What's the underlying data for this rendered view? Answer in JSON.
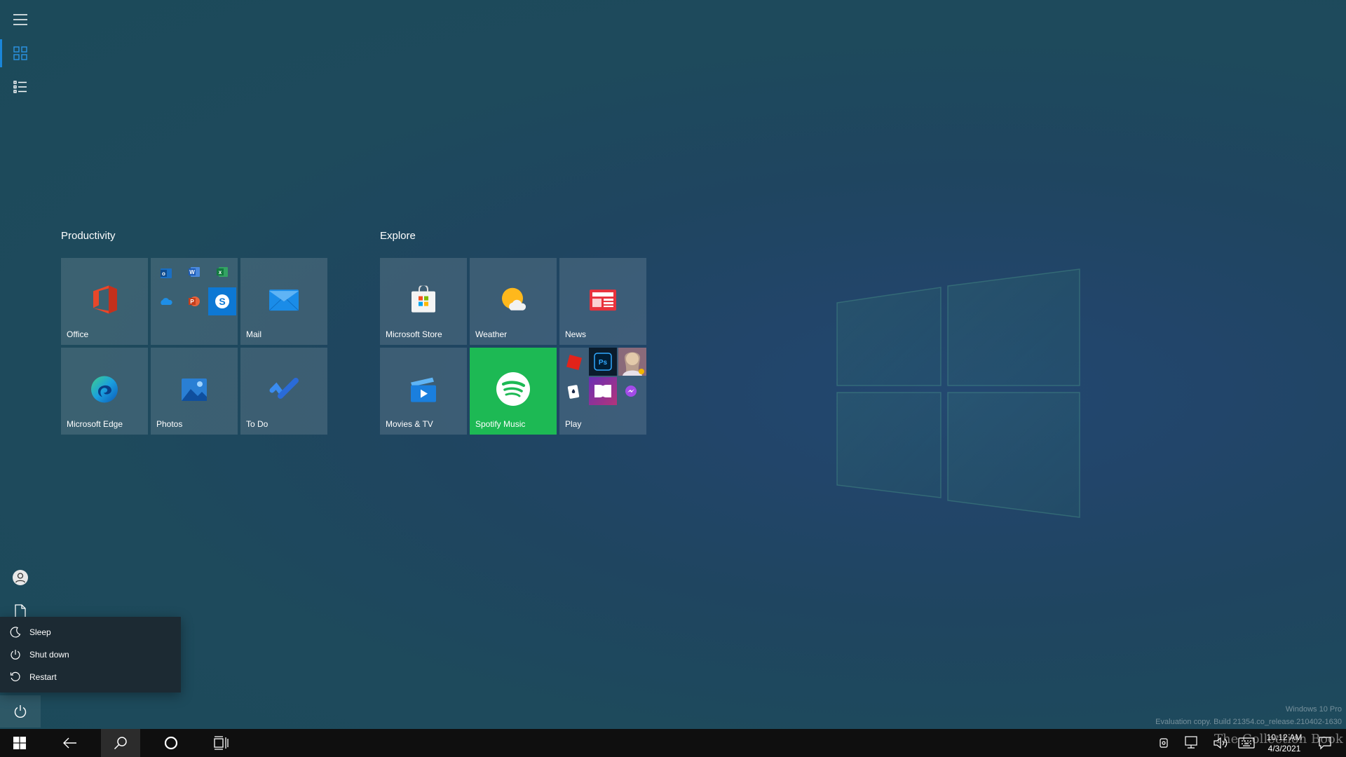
{
  "groups": [
    {
      "title": "Productivity"
    },
    {
      "title": "Explore"
    }
  ],
  "tiles": {
    "office": "Office",
    "mail": "Mail",
    "edge": "Microsoft Edge",
    "photos": "Photos",
    "todo": "To Do",
    "store": "Microsoft Store",
    "weather": "Weather",
    "news": "News",
    "movies": "Movies & TV",
    "spotify": "Spotify Music",
    "play": "Play"
  },
  "office_folder_apps": [
    "outlook-icon",
    "word-icon",
    "excel-icon",
    "onedrive-icon",
    "powerpoint-icon",
    "skype-icon"
  ],
  "play_folder_apps": [
    "roblox-icon",
    "photoshop-express-icon",
    "game-avatar-icon",
    "solitaire-icon",
    "dolby-icon",
    "messenger-icon"
  ],
  "power_menu": {
    "items": [
      {
        "label": "Sleep",
        "icon": "moon-icon"
      },
      {
        "label": "Shut down",
        "icon": "power-icon"
      },
      {
        "label": "Restart",
        "icon": "restart-icon"
      }
    ]
  },
  "taskbar": {
    "time": "10:12 AM",
    "date": "4/3/2021"
  },
  "watermark": {
    "edition": "Windows 10 Pro",
    "build": "Evaluation copy. Build 21354.co_release.210402-1630",
    "brand": "The Collection Book"
  },
  "colors": {
    "accent": "#1a86d9",
    "spotify": "#1db954",
    "taskbar": "#0f0f0f"
  }
}
